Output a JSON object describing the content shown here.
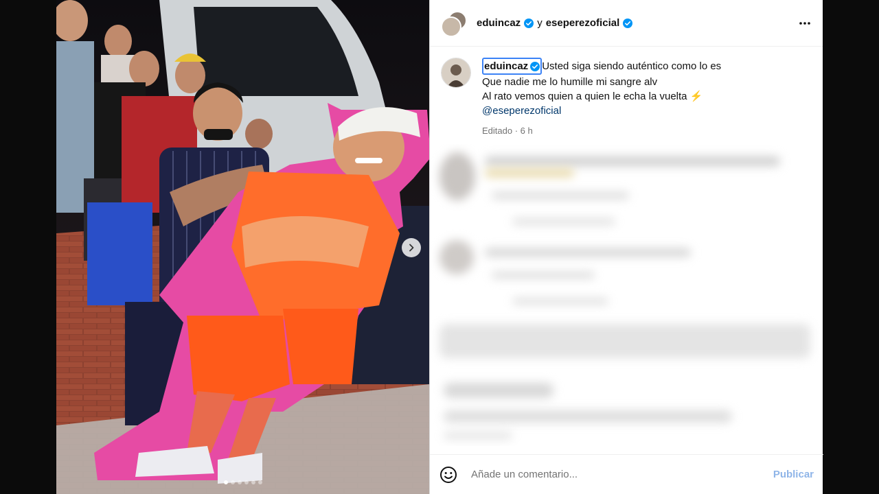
{
  "header": {
    "user1": "eduincaz",
    "conjunction": "y",
    "user2": "eseperezoficial",
    "more_icon": "more-horizontal-icon"
  },
  "caption": {
    "username": "eduincaz",
    "lines": [
      "Usted siga siendo auténtico como lo es",
      "Que nadie me lo humille mi sangre alv",
      "Al rato vemos quien a quien le echa la vuelta ⚡"
    ],
    "mention": "@eseperezoficial",
    "edited_label": "Editado",
    "time": "6 h"
  },
  "media": {
    "carousel_total": 6,
    "carousel_active": 1
  },
  "footer": {
    "placeholder": "Añade un comentario...",
    "publish_label": "Publicar"
  },
  "colors": {
    "verified": "#0095f6",
    "publish": "#8fb5e8",
    "mention": "#00376b"
  }
}
